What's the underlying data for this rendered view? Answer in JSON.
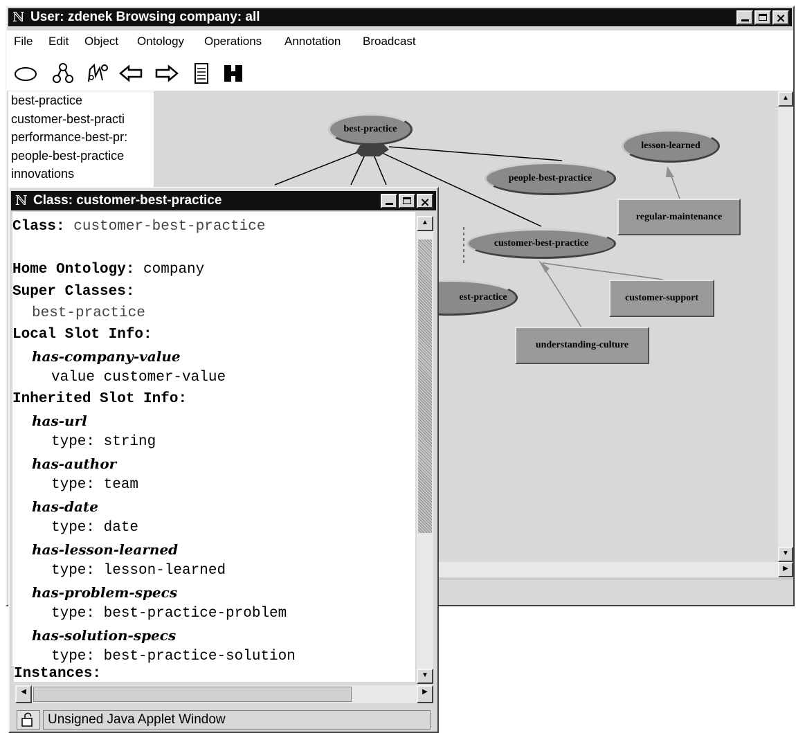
{
  "main_window": {
    "title": "User: zdenek Browsing company: all",
    "menu": [
      "File",
      "Edit",
      "Object",
      "Ontology",
      "Operations",
      "Annotation",
      "Broadcast"
    ],
    "toolbar_icons": [
      "ellipse-icon",
      "hierarchy-icon",
      "graph-icon",
      "arrow-left-icon",
      "arrow-right-icon",
      "document-icon",
      "h-icon"
    ],
    "class_list": [
      "best-practice",
      "customer-best-practi",
      "performance-best-pr:",
      "people-best-practice",
      "innovations"
    ]
  },
  "graph": {
    "ovals": [
      "best-practice",
      "lesson-learned",
      "people-best-practice",
      "customer-best-practice",
      "est-practice"
    ],
    "rects": [
      "regular-maintenance",
      "customer-support",
      "understanding-culture"
    ]
  },
  "class_window": {
    "title": "Class: customer-best-practice",
    "heading_label": "Class:",
    "heading_value": "customer-best-practice",
    "home_label": "Home Ontology:",
    "home_value": "company",
    "super_label": "Super Classes:",
    "super_value": "best-practice",
    "local_label": "Local Slot Info:",
    "local_slots": [
      {
        "name": "has-company-value",
        "detail": "value customer-value"
      }
    ],
    "inherited_label": "Inherited Slot Info:",
    "inherited_slots": [
      {
        "name": "has-url",
        "detail": "type: string"
      },
      {
        "name": "has-author",
        "detail": "type: team"
      },
      {
        "name": "has-date",
        "detail": "type: date"
      },
      {
        "name": "has-lesson-learned",
        "detail": "type: lesson-learned"
      },
      {
        "name": "has-problem-specs",
        "detail": "type: best-practice-problem"
      },
      {
        "name": "has-solution-specs",
        "detail": "type: best-practice-solution"
      }
    ],
    "instances_label": "Instances:",
    "status": "Unsigned Java Applet Window"
  }
}
